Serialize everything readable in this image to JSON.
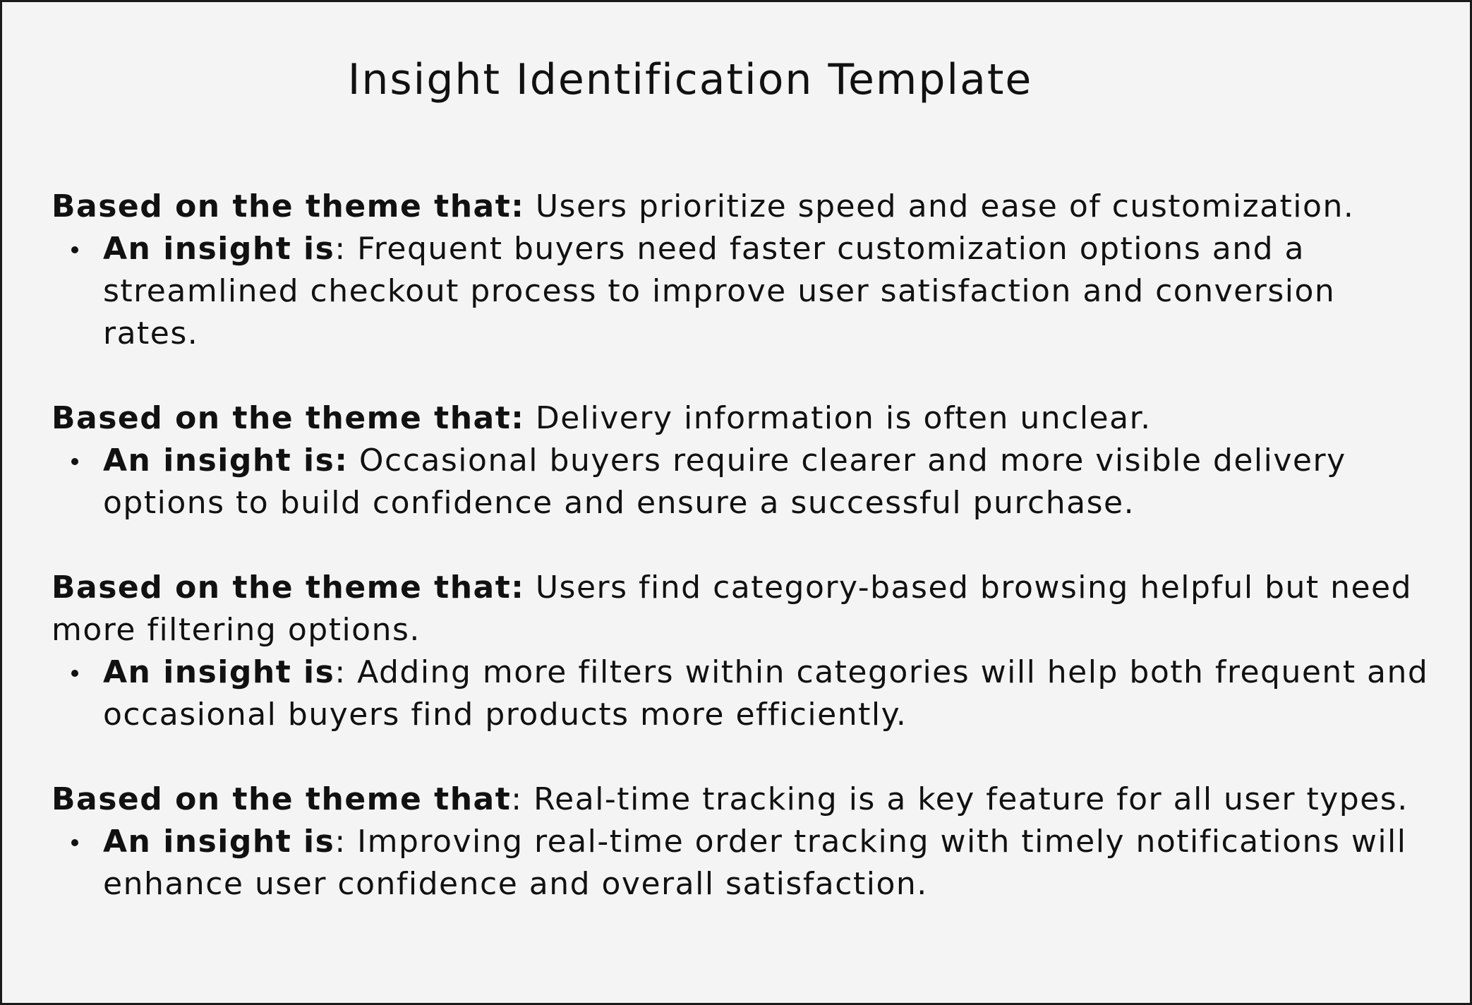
{
  "title": "Insight Identification Template",
  "items": [
    {
      "theme_label": "Based on the theme that:",
      "theme_label_rest": "",
      "theme_text": " Users prioritize speed and ease of customization.",
      "insight_label": "An insight is",
      "insight_label_rest": ":",
      "insight_text": " Frequent buyers need faster customization options and a streamlined checkout process to improve user satisfaction and conversion rates."
    },
    {
      "theme_label": "Based on the theme that:",
      "theme_label_rest": "",
      "theme_text": " Delivery information is often unclear.",
      "insight_label": "An insight is:",
      "insight_label_rest": "",
      "insight_text": " Occasional buyers require clearer and more visible delivery options to build confidence and ensure a successful purchase."
    },
    {
      "theme_label": "Based on the theme that:",
      "theme_label_rest": "",
      "theme_text": " Users find category-based browsing helpful but need more filtering options.",
      "insight_label": "An insight is",
      "insight_label_rest": ":",
      "insight_text": " Adding more filters within categories will help both frequent and occasional buyers find products more efficiently."
    },
    {
      "theme_label": "Based on the theme that",
      "theme_label_rest": ":",
      "theme_text": " Real-time tracking is a key feature for all user types.",
      "insight_label": "An insight is",
      "insight_label_rest": ":",
      "insight_text": " Improving real-time order tracking with timely notifications will enhance user confidence and overall satisfaction."
    }
  ]
}
